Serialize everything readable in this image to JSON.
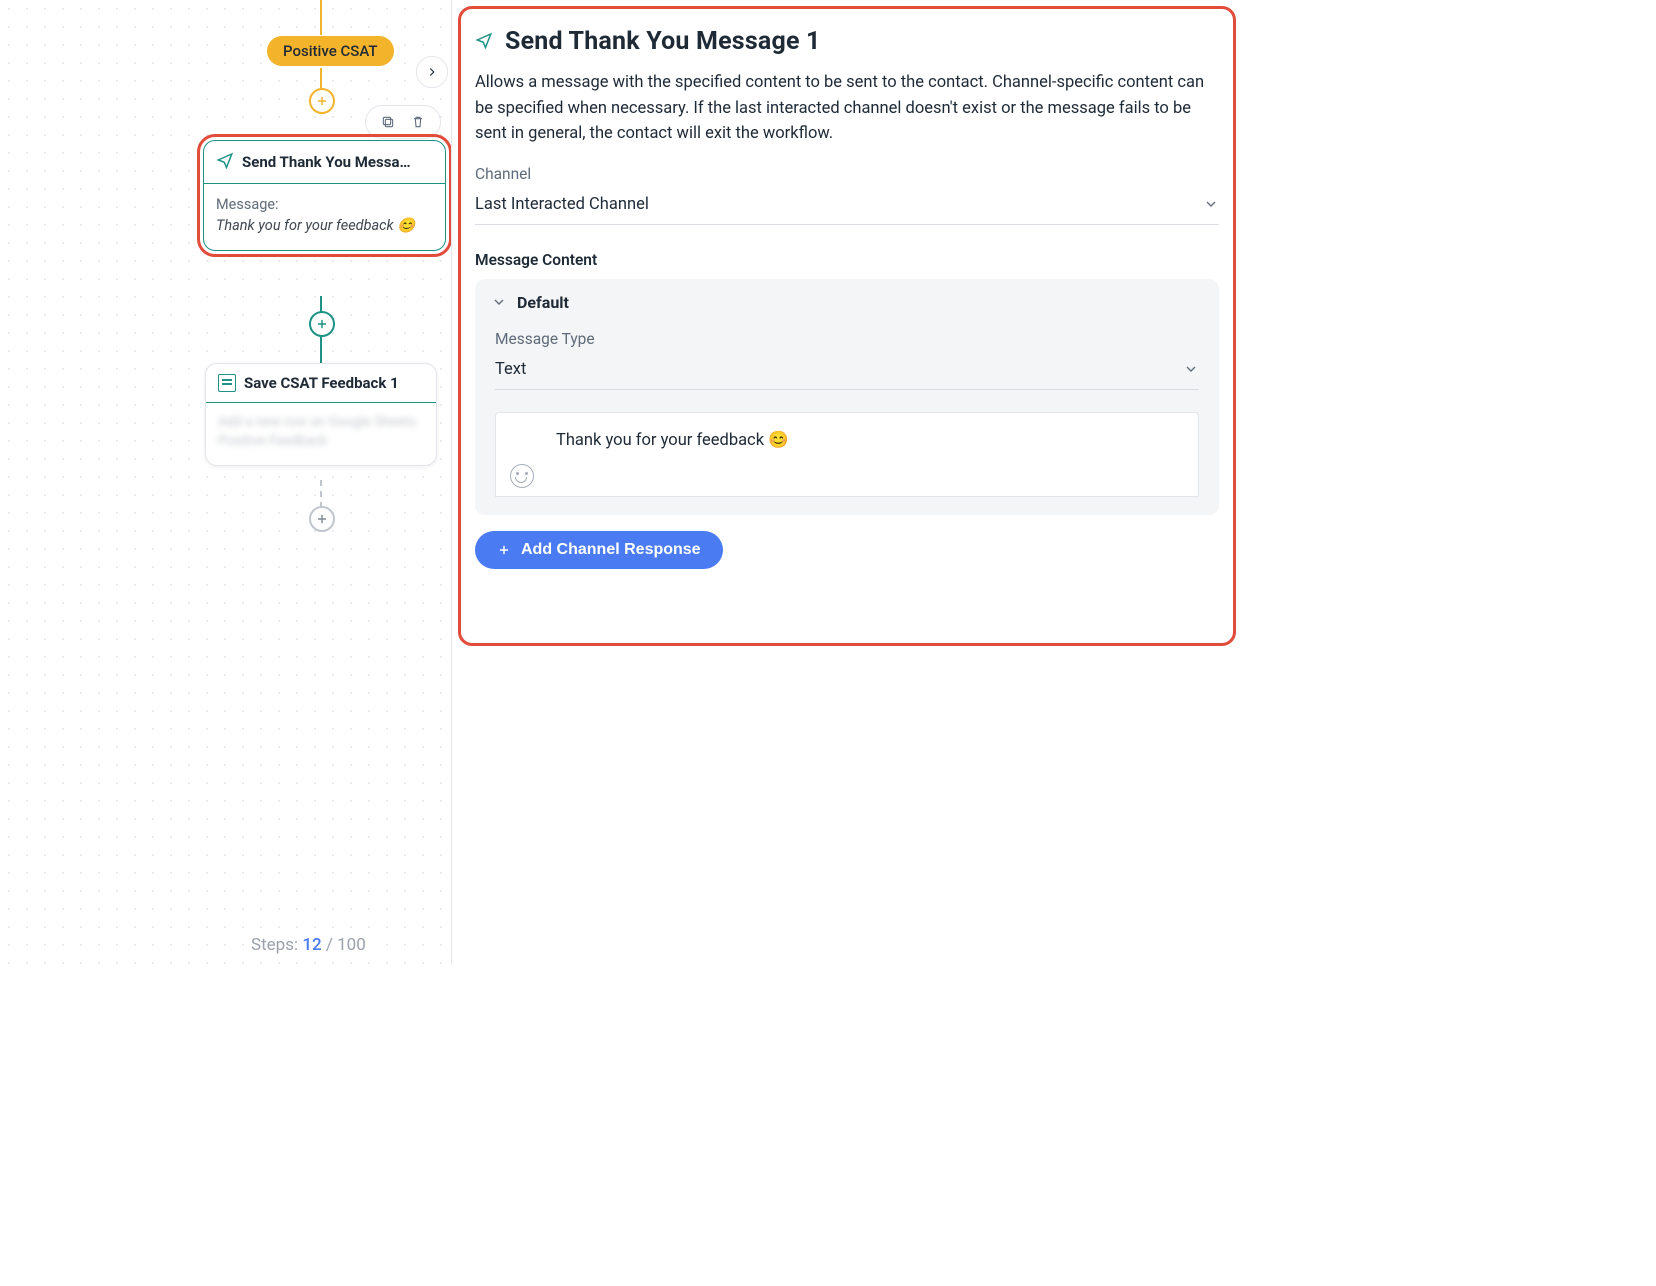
{
  "canvas": {
    "pill_label": "Positive CSAT",
    "node1": {
      "title": "Send Thank You Messa…",
      "body_label": "Message:",
      "body_msg": "Thank you for your feedback 😊"
    },
    "node2": {
      "title": "Save CSAT Feedback 1",
      "body": "Add a new row on Google Sheets: Positive Feedback"
    },
    "steps": {
      "prefix": "Steps: ",
      "current": "12",
      "sep": " / ",
      "total": "100"
    }
  },
  "panel": {
    "title": "Send Thank You Message 1",
    "description": "Allows a message with the specified content to be sent to the contact. Channel-specific content can be specified when necessary. If the last interacted channel doesn't exist or the message fails to be sent in general, the contact will exit the workflow.",
    "channel_label": "Channel",
    "channel_value": "Last Interacted Channel",
    "message_content_label": "Message Content",
    "default_label": "Default",
    "message_type_label": "Message Type",
    "message_type_value": "Text",
    "message_text": "Thank you for your feedback 😊",
    "add_channel_btn": "Add Channel Response"
  }
}
